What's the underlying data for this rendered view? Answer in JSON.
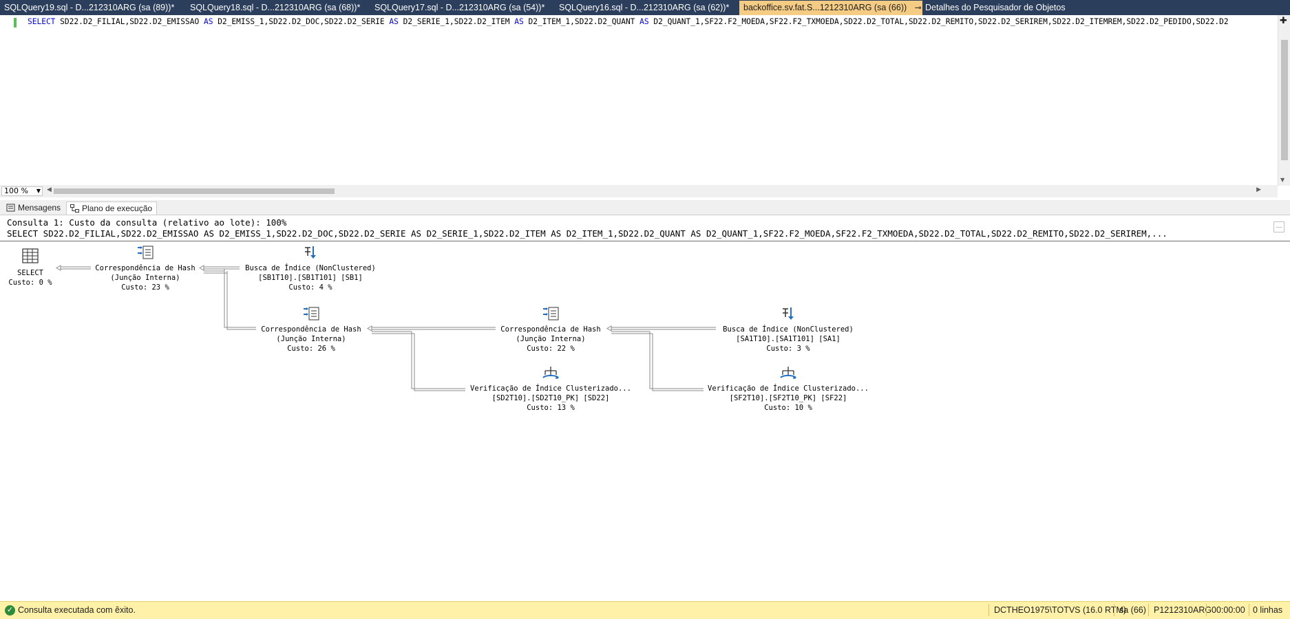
{
  "tabs": [
    {
      "label": "SQLQuery19.sql - D...212310ARG (sa (89))*"
    },
    {
      "label": "SQLQuery18.sql - D...212310ARG (sa (68))*"
    },
    {
      "label": "SQLQuery17.sql - D...212310ARG (sa (54))*"
    },
    {
      "label": "SQLQuery16.sql - D...212310ARG (sa (62))*"
    },
    {
      "label": "backoffice.sv.fat.S...1212310ARG (sa (66))",
      "active": true
    },
    {
      "label": "Detalhes do Pesquisador de Objetos"
    }
  ],
  "tab_pin_glyph": "⊸",
  "tab_close_glyph": "✕",
  "editor": {
    "sql_parts": [
      {
        "t": "SELECT",
        "kw": true
      },
      {
        "t": " SD22.D2_FILIAL,SD22.D2_EMISSAO ",
        "kw": false
      },
      {
        "t": "AS",
        "kw": true
      },
      {
        "t": " D2_EMISS_1,SD22.D2_DOC,SD22.D2_SERIE ",
        "kw": false
      },
      {
        "t": "AS",
        "kw": true
      },
      {
        "t": " D2_SERIE_1,SD22.D2_ITEM ",
        "kw": false
      },
      {
        "t": "AS",
        "kw": true
      },
      {
        "t": " D2_ITEM_1,SD22.D2_QUANT ",
        "kw": false
      },
      {
        "t": "AS",
        "kw": true
      },
      {
        "t": " D2_QUANT_1,SF22.F2_MOEDA,SF22.F2_TXMOEDA,SD22.D2_TOTAL,SD22.D2_REMITO,SD22.D2_SERIREM,SD22.D2_ITEMREM,SD22.D2_PEDIDO,SD22.D2",
        "kw": false
      }
    ],
    "zoom": "100 %"
  },
  "result_tabs": {
    "messages": "Mensagens",
    "plan": "Plano de execução"
  },
  "plan": {
    "header_line1": "Consulta 1: Custo da consulta (relativo ao lote): 100%",
    "header_line2": "SELECT SD22.D2_FILIAL,SD22.D2_EMISSAO AS D2_EMISS_1,SD22.D2_DOC,SD22.D2_SERIE AS D2_SERIE_1,SD22.D2_ITEM AS D2_ITEM_1,SD22.D2_QUANT AS D2_QUANT_1,SF22.F2_MOEDA,SF22.F2_TXMOEDA,SD22.D2_TOTAL,SD22.D2_REMITO,SD22.D2_SERIREM,...",
    "nodes": [
      {
        "id": "select",
        "icon": "select-icon",
        "lines": [
          "SELECT",
          "Custo: 0 %"
        ]
      },
      {
        "id": "hash1",
        "icon": "hash-match-icon",
        "lines": [
          "Correspondência de Hash",
          "(Junção Interna)",
          "Custo: 23 %"
        ]
      },
      {
        "id": "seek1",
        "icon": "index-seek-icon",
        "lines": [
          "Busca de Índice (NonClustered)",
          "[SB1T10].[SB1T101] [SB1]",
          "Custo: 4 %"
        ]
      },
      {
        "id": "hash2",
        "icon": "hash-match-icon",
        "lines": [
          "Correspondência de Hash",
          "(Junção Interna)",
          "Custo: 26 %"
        ]
      },
      {
        "id": "hash3",
        "icon": "hash-match-icon",
        "lines": [
          "Correspondência de Hash",
          "(Junção Interna)",
          "Custo: 22 %"
        ]
      },
      {
        "id": "seek2",
        "icon": "index-seek-icon",
        "lines": [
          "Busca de Índice (NonClustered)",
          "[SA1T10].[SA1T101] [SA1]",
          "Custo: 3 %"
        ]
      },
      {
        "id": "scan1",
        "icon": "clustered-index-scan-icon",
        "lines": [
          "Verificação de Índice Clusterizado...",
          "[SD2T10].[SD2T10_PK] [SD22]",
          "Custo: 13 %"
        ]
      },
      {
        "id": "scan2",
        "icon": "clustered-index-scan-icon",
        "lines": [
          "Verificação de Índice Clusterizado...",
          "[SF2T10].[SF2T10_PK] [SF22]",
          "Custo: 10 %"
        ]
      }
    ]
  },
  "status": {
    "message": "Consulta executada com êxito.",
    "server": "DCTHEO1975\\TOTVS (16.0 RTM)",
    "user": "sa (66)",
    "database": "P1212310ARG",
    "elapsed": "00:00:00",
    "rows": "0 linhas"
  },
  "colors": {
    "tab_strip": "#2b3e5c",
    "active_tab": "#f5cc84",
    "status_bar": "#fff2a8",
    "keyword": "#0000ff"
  }
}
